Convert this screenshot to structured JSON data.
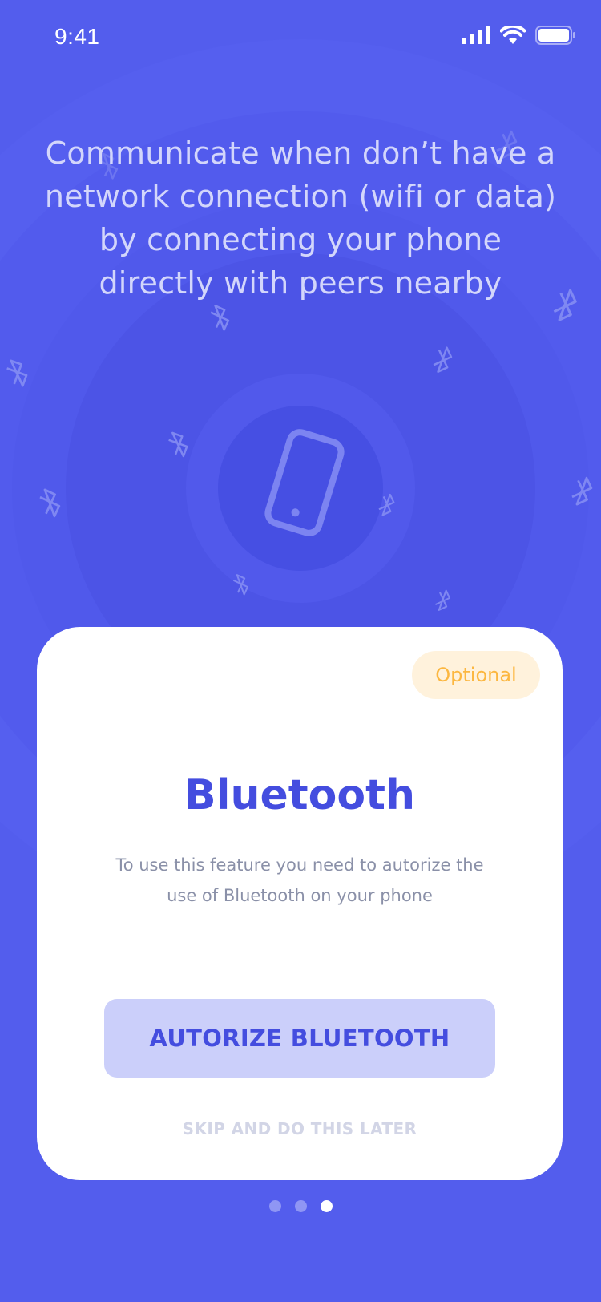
{
  "status_bar": {
    "time": "9:41",
    "icons": [
      "signal-icon",
      "wifi-icon",
      "battery-icon"
    ]
  },
  "intro": {
    "headline_lines": [
      "Communicate when don’t have a",
      "network connection (wifi or data)",
      "by connecting your phone",
      "directly with peers nearby"
    ]
  },
  "illustration": {
    "center_icon": "phone-icon",
    "scattered_icon": "bluetooth-icon"
  },
  "card": {
    "badge": "Optional",
    "title": "Bluetooth",
    "description": "To use this feature you need to autorize the use of Bluetooth on your phone",
    "primary_button": "AUTORIZE BLUETOOTH",
    "skip_link": "SKIP AND DO THIS LATER"
  },
  "pagination": {
    "total": 3,
    "current": 3
  },
  "colors": {
    "background": "#535ded",
    "accent": "#444ddf",
    "badge_bg": "#fff2dc",
    "badge_text": "#fcb740",
    "button_bg": "#cbcffa"
  }
}
